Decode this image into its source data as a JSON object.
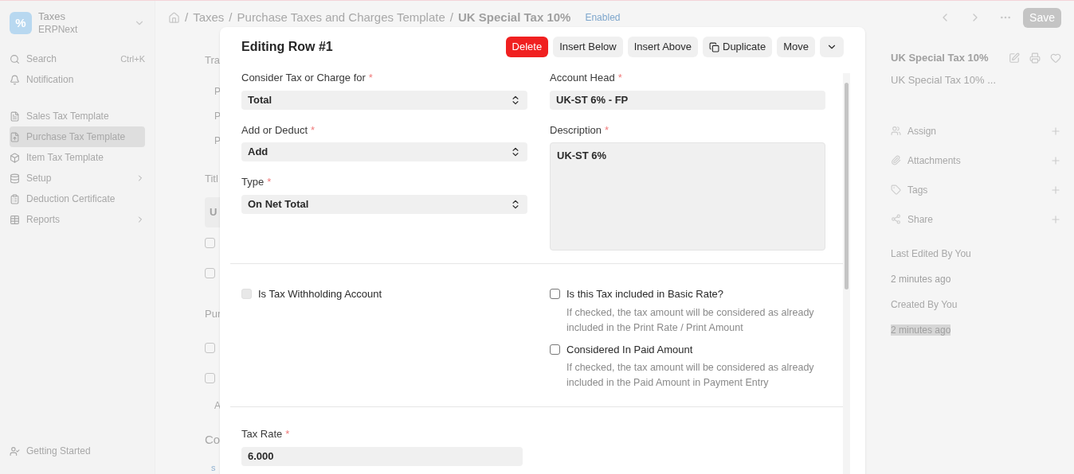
{
  "sidebar": {
    "app": {
      "title": "Taxes",
      "subtitle": "ERPNext",
      "logo": "%"
    },
    "search": {
      "label": "Search",
      "shortcut": "Ctrl+K"
    },
    "notification": "Notification",
    "items": [
      {
        "label": "Sales Tax Template",
        "has_submenu": false,
        "selected": false
      },
      {
        "label": "Purchase Tax Template",
        "has_submenu": false,
        "selected": true
      },
      {
        "label": "Item Tax Template",
        "has_submenu": false,
        "selected": false
      },
      {
        "label": "Setup",
        "has_submenu": true,
        "selected": false
      },
      {
        "label": "Deduction Certificate",
        "has_submenu": false,
        "selected": false
      },
      {
        "label": "Reports",
        "has_submenu": true,
        "selected": false
      }
    ],
    "footer": "Getting Started"
  },
  "breadcrumb": {
    "separator": "/",
    "items": [
      "Taxes",
      "Purchase Taxes and Charges Template",
      "UK Special Tax 10%"
    ],
    "status": "Enabled"
  },
  "toolbar": {
    "save": "Save"
  },
  "background_form": {
    "fragments": [
      {
        "kind": "label",
        "text": "Tra"
      },
      {
        "kind": "cell",
        "text": "P"
      },
      {
        "kind": "cell",
        "text": "P"
      },
      {
        "kind": "cell",
        "text": "P"
      },
      {
        "kind": "label",
        "text": "Titl"
      },
      {
        "kind": "field",
        "text": "U"
      },
      {
        "kind": "checkbox",
        "checked": false
      },
      {
        "kind": "checkbox",
        "checked": false
      },
      {
        "kind": "label",
        "text": "Pur"
      },
      {
        "kind": "checkbox",
        "checked": false
      },
      {
        "kind": "checkbox",
        "checked": false
      },
      {
        "kind": "cell",
        "text": "A"
      },
      {
        "kind": "heading",
        "text": "Co"
      },
      {
        "kind": "link",
        "text": "s"
      }
    ]
  },
  "modal": {
    "title": "Editing Row #1",
    "buttons": [
      {
        "label": "Delete",
        "kind": "danger"
      },
      {
        "label": "Insert Below",
        "kind": "default"
      },
      {
        "label": "Insert Above",
        "kind": "default"
      },
      {
        "label": "Duplicate",
        "kind": "copy"
      },
      {
        "label": "Move",
        "kind": "default"
      },
      {
        "kind": "menu"
      }
    ],
    "left_fields": [
      {
        "label": "Consider Tax or Charge for",
        "required_mark": "*",
        "kind": "select",
        "value": "Total"
      },
      {
        "label": "Add or Deduct",
        "required_mark": "*",
        "kind": "select",
        "value": "Add"
      },
      {
        "label": "Type",
        "required_mark": "*",
        "kind": "select",
        "value": "On Net Total"
      }
    ],
    "right_fields": [
      {
        "label": "Account Head",
        "required_mark": "*",
        "kind": "input",
        "value": "UK-ST 6% - FP"
      },
      {
        "label": "Description",
        "required_mark": "*",
        "kind": "textarea",
        "value": "UK-ST 6%"
      }
    ],
    "left_checks": [
      {
        "label": "Is Tax Withholding Account",
        "checked": false,
        "disabled": true
      }
    ],
    "right_checks": [
      {
        "label": "Is this Tax included in Basic Rate?",
        "checked": false,
        "disabled": false,
        "help": "If checked, the tax amount will be considered as already included in the Print Rate / Print Amount"
      },
      {
        "label": "Considered In Paid Amount",
        "checked": false,
        "disabled": false,
        "help": "If checked, the tax amount will be considered as already included in the Paid Amount in Payment Entry"
      }
    ],
    "tax_rate": {
      "label": "Tax Rate",
      "required_mark": "*",
      "value": "6.000"
    }
  },
  "side_panel": {
    "title": "UK Special Tax 10%",
    "subtitle": "UK Special Tax 10% ...",
    "sections": [
      "Assign",
      "Attachments",
      "Tags",
      "Share"
    ],
    "activity": [
      {
        "label": "Last Edited By You",
        "time": "2 minutes ago",
        "highlighted": false
      },
      {
        "label": "Created By You",
        "time": "2 minutes ago",
        "highlighted": true
      }
    ]
  }
}
